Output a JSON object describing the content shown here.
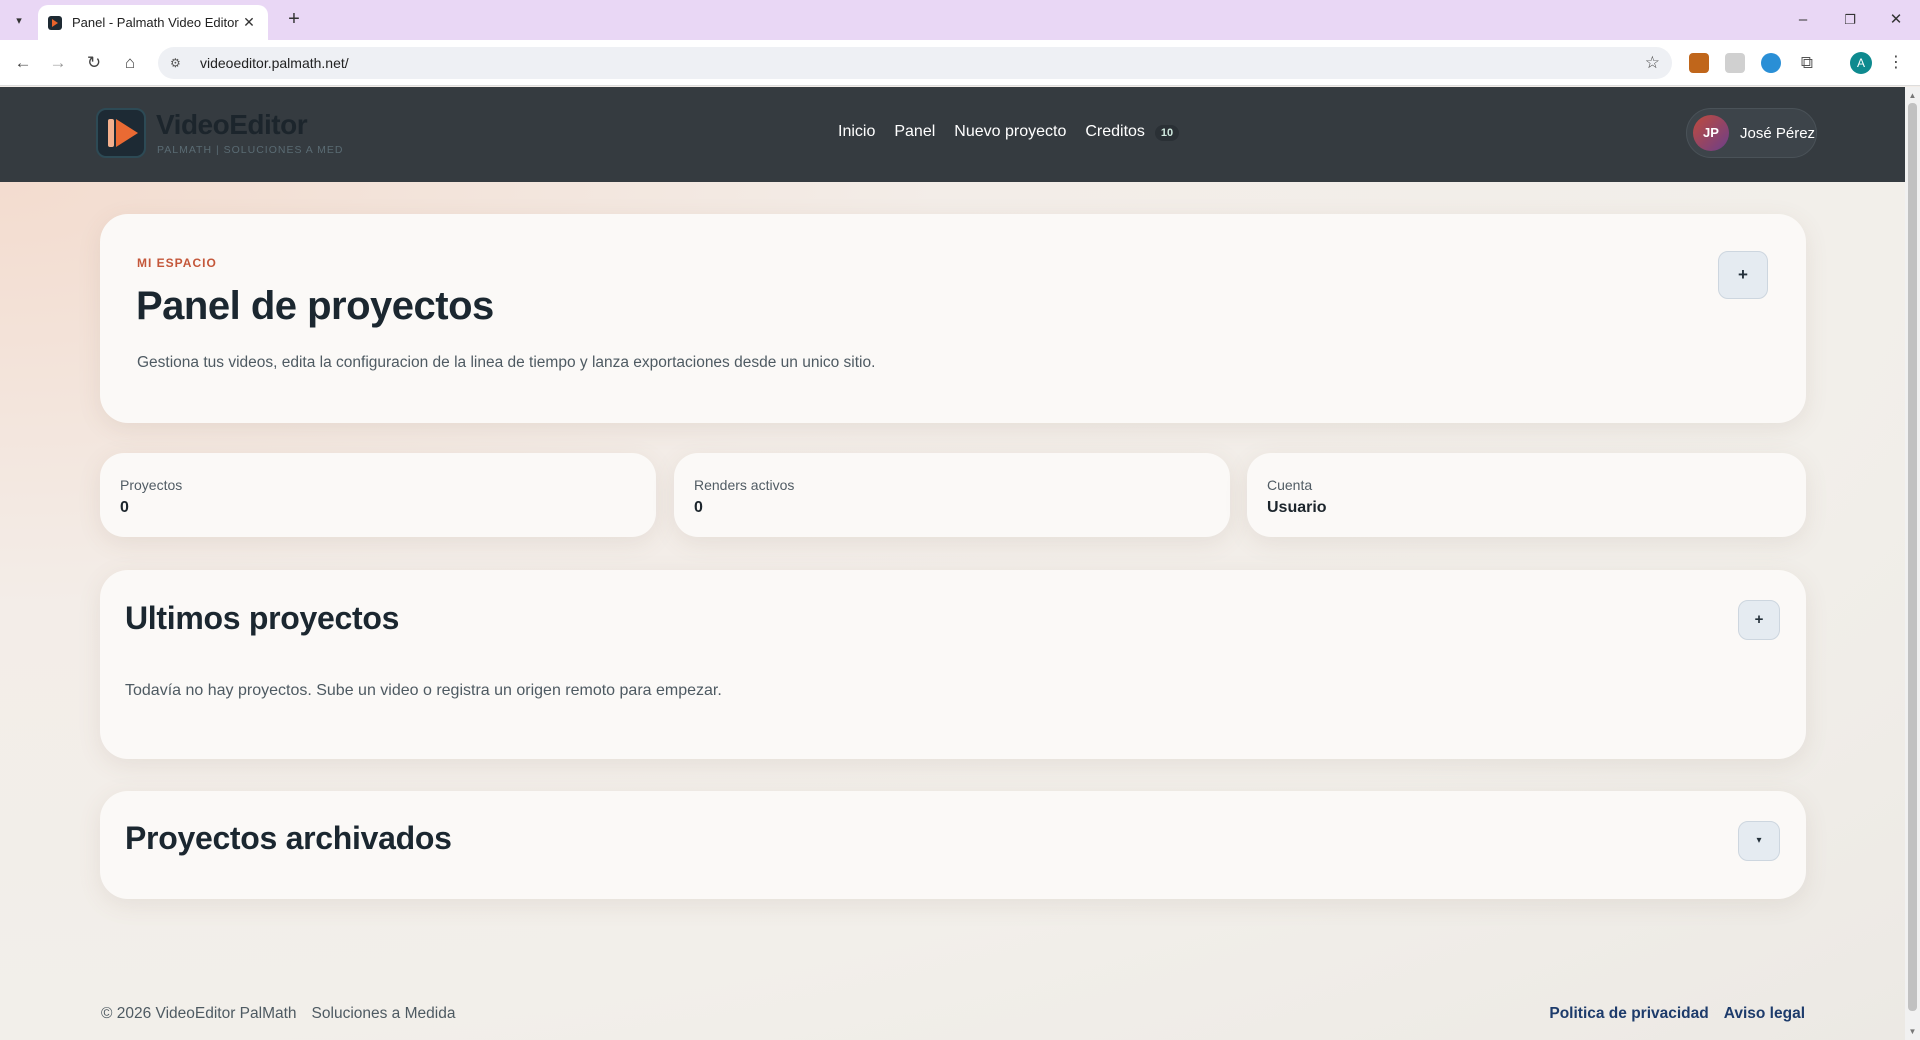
{
  "browser": {
    "tab_title": "Panel - Palmath Video Editor",
    "url": "videoeditor.palmath.net/",
    "profile_initial": "A",
    "extensions": [
      {
        "name": "palette-extension-icon",
        "color": "#c0661b"
      },
      {
        "name": "monitor-extension-icon",
        "color": "#d0d0d0"
      },
      {
        "name": "download-extension-icon",
        "color": "#2a8fd6"
      },
      {
        "name": "puzzle-extensions-icon",
        "color": "#555555"
      }
    ]
  },
  "header": {
    "brand_title": "VideoEditor",
    "brand_subtitle": "PALMATH | SOLUCIONES A MED",
    "nav": {
      "inicio": "Inicio",
      "panel": "Panel",
      "nuevo_proyecto": "Nuevo proyecto",
      "creditos": "Creditos",
      "creditos_count": "10"
    },
    "user": {
      "initials": "JP",
      "name": "José Pérez"
    }
  },
  "hero": {
    "eyebrow": "MI ESPACIO",
    "title": "Panel de proyectos",
    "description": "Gestiona tus videos, edita la configuracion de la linea de tiempo y lanza exportaciones desde un unico sitio.",
    "action_icon": "+"
  },
  "stats": [
    {
      "label": "Proyectos",
      "value": "0"
    },
    {
      "label": "Renders activos",
      "value": "0"
    },
    {
      "label": "Cuenta",
      "value": "Usuario"
    }
  ],
  "recent": {
    "title": "Ultimos proyectos",
    "action_icon": "+",
    "empty_message": "Todavía no hay proyectos. Sube un video o registra un origen remoto para empezar."
  },
  "archived": {
    "title": "Proyectos archivados",
    "toggle_icon": "▾"
  },
  "footer": {
    "copyright": "© 2026 VideoEditor PalMath",
    "tagline": "Soluciones a Medida",
    "privacy": "Politica de privacidad",
    "legal": "Aviso legal"
  }
}
